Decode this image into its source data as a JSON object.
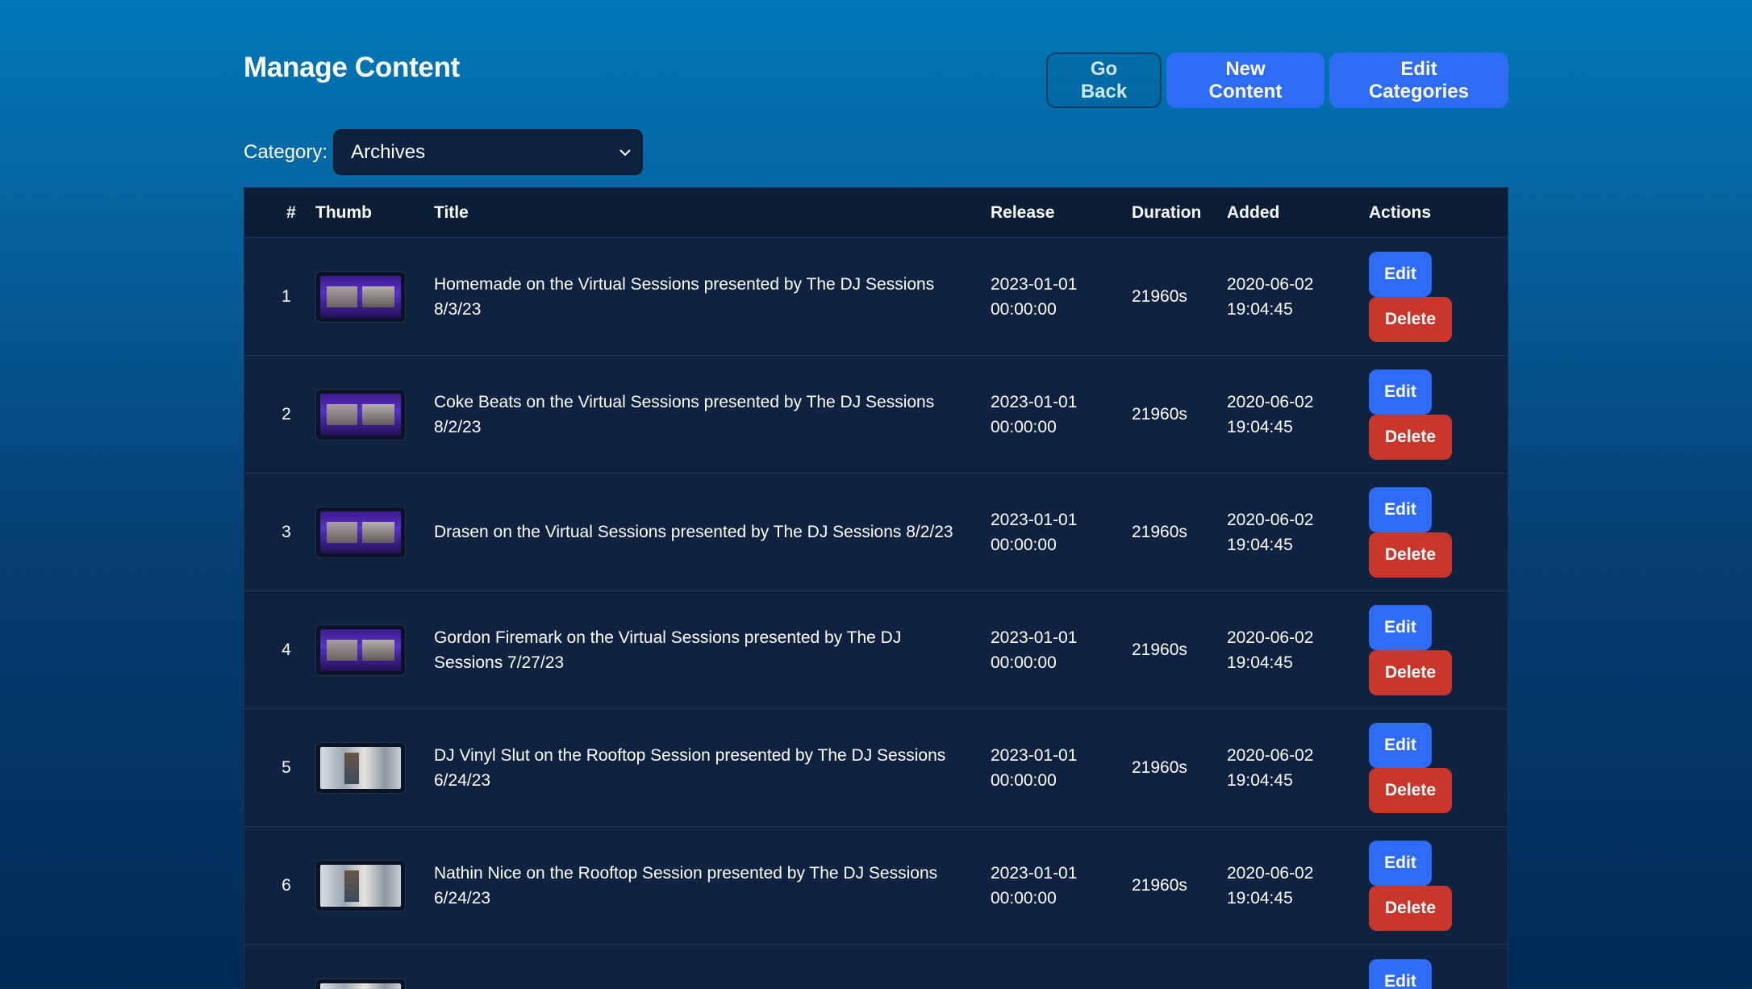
{
  "header": {
    "title": "Manage Content",
    "go_back_label": "Go Back",
    "new_content_label": "New Content",
    "edit_categories_label": "Edit Categories"
  },
  "filter": {
    "label": "Category:",
    "selected": "Archives"
  },
  "table": {
    "columns": {
      "num": "#",
      "thumb": "Thumb",
      "title": "Title",
      "release": "Release",
      "duration": "Duration",
      "added": "Added",
      "actions": "Actions"
    },
    "edit_label": "Edit",
    "delete_label": "Delete",
    "rows": [
      {
        "num": "1",
        "title": "Homemade on the Virtual Sessions presented by The DJ Sessions 8/3/23",
        "release_date": "2023-01-01",
        "release_time": "00:00:00",
        "duration": "21960s",
        "added_date": "2020-06-02",
        "added_time": "19:04:45",
        "thumb": "purple"
      },
      {
        "num": "2",
        "title": "Coke Beats on the Virtual Sessions presented by The DJ Sessions 8/2/23",
        "release_date": "2023-01-01",
        "release_time": "00:00:00",
        "duration": "21960s",
        "added_date": "2020-06-02",
        "added_time": "19:04:45",
        "thumb": "purple"
      },
      {
        "num": "3",
        "title": "Drasen on the Virtual Sessions presented by The DJ Sessions 8/2/23",
        "release_date": "2023-01-01",
        "release_time": "00:00:00",
        "duration": "21960s",
        "added_date": "2020-06-02",
        "added_time": "19:04:45",
        "thumb": "purple"
      },
      {
        "num": "4",
        "title": "Gordon Firemark on the Virtual Sessions presented by The DJ Sessions 7/27/23",
        "release_date": "2023-01-01",
        "release_time": "00:00:00",
        "duration": "21960s",
        "added_date": "2020-06-02",
        "added_time": "19:04:45",
        "thumb": "purple"
      },
      {
        "num": "5",
        "title": "DJ Vinyl Slut on the Rooftop Session presented by The DJ Sessions 6/24/23",
        "release_date": "2023-01-01",
        "release_time": "00:00:00",
        "duration": "21960s",
        "added_date": "2020-06-02",
        "added_time": "19:04:45",
        "thumb": "photo"
      },
      {
        "num": "6",
        "title": "Nathin Nice on the Rooftop Session presented by The DJ Sessions 6/24/23",
        "release_date": "2023-01-01",
        "release_time": "00:00:00",
        "duration": "21960s",
        "added_date": "2020-06-02",
        "added_time": "19:04:45",
        "thumb": "photo"
      }
    ]
  },
  "colors": {
    "primary": "#2f6cf6",
    "danger": "#c9372c",
    "table_bg": "#0f2340"
  },
  "icons": {
    "select_chevron": "chevron-down-icon"
  }
}
